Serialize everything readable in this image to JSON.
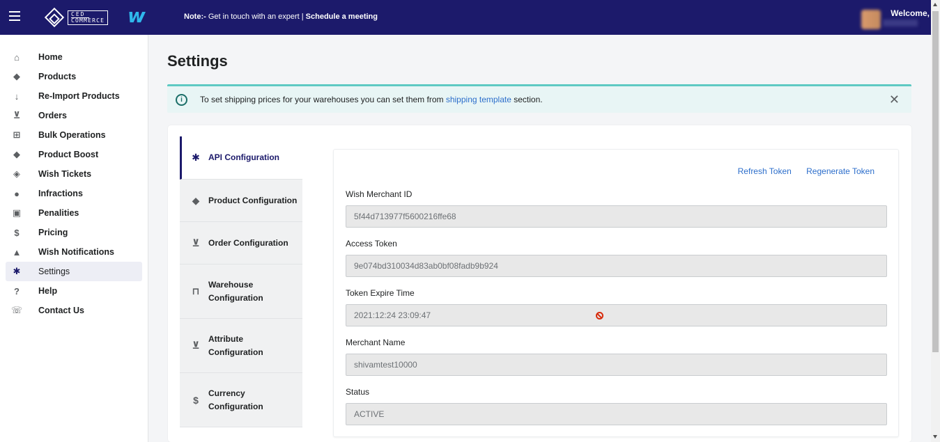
{
  "topbar": {
    "brand_top": "CED",
    "brand_bottom": "COMMERCE",
    "wish_logo": "w",
    "note_prefix": "Note:-",
    "note_text": " Get in touch with an expert | ",
    "note_link": "Schedule a meeting",
    "welcome": "Welcome,"
  },
  "sidebar": {
    "items": [
      {
        "label": "Home",
        "icon": "home-icon",
        "glyph": "⌂"
      },
      {
        "label": "Products",
        "icon": "tag-icon",
        "glyph": "◆"
      },
      {
        "label": "Re-Import Products",
        "icon": "arrow-down-icon",
        "glyph": "↓"
      },
      {
        "label": "Orders",
        "icon": "inbox-download-icon",
        "glyph": "⊻"
      },
      {
        "label": "Bulk Operations",
        "icon": "grid-plus-icon",
        "glyph": "⊞"
      },
      {
        "label": "Product Boost",
        "icon": "tag-icon",
        "glyph": "◆"
      },
      {
        "label": "Wish Tickets",
        "icon": "ticket-icon",
        "glyph": "◈"
      },
      {
        "label": "Infractions",
        "icon": "alert-icon",
        "glyph": "●"
      },
      {
        "label": "Penalities",
        "icon": "percent-icon",
        "glyph": "▣"
      },
      {
        "label": "Pricing",
        "icon": "dollar-icon",
        "glyph": "$"
      },
      {
        "label": "Wish Notifications",
        "icon": "bell-icon",
        "glyph": "▲"
      },
      {
        "label": "Settings",
        "icon": "gear-icon",
        "glyph": "✱"
      },
      {
        "label": "Help",
        "icon": "question-icon",
        "glyph": "?"
      },
      {
        "label": "Contact Us",
        "icon": "phone-icon",
        "glyph": "☏"
      }
    ],
    "active_index": 11
  },
  "page": {
    "title": "Settings"
  },
  "banner": {
    "text_before": "To set shipping prices for your warehouses you can set them from ",
    "link": "shipping template",
    "text_after": " section.",
    "close_glyph": "✕"
  },
  "tabs": [
    {
      "label": "API Configuration",
      "icon": "gear-icon",
      "glyph": "✱"
    },
    {
      "label": "Product Configuration",
      "icon": "tag-icon",
      "glyph": "◆"
    },
    {
      "label": "Order Configuration",
      "icon": "inbox-download-icon",
      "glyph": "⊻"
    },
    {
      "label": "Warehouse Configuration",
      "label_l1": "Warehouse",
      "label_l2": "Configuration",
      "icon": "store-icon",
      "glyph": "⊓"
    },
    {
      "label": "Attribute Configuration",
      "label_l1": "Attribute",
      "label_l2": "Configuration",
      "icon": "import-icon",
      "glyph": "⊻"
    },
    {
      "label": "Currency Configuration",
      "label_l1": "Currency",
      "label_l2": "Configuration",
      "icon": "dollar-icon",
      "glyph": "$"
    }
  ],
  "api": {
    "refresh_token": "Refresh Token",
    "regenerate_token": "Regenerate Token",
    "fields": [
      {
        "label": "Wish Merchant ID",
        "value": "5f44d713977f5600216ffe68"
      },
      {
        "label": "Access Token",
        "value": "9e074bd310034d83ab0bf08fadb9b924"
      },
      {
        "label": "Token Expire Time",
        "value": "2021:12:24 23:09:47"
      },
      {
        "label": "Merchant Name",
        "value": "shivamtest10000"
      },
      {
        "label": "Status",
        "value": "ACTIVE"
      }
    ]
  },
  "colors": {
    "topbar": "#1c1a6b",
    "link": "#2c6ecb",
    "banner_bg": "#e8f5f5",
    "banner_border": "#5ec9c3"
  }
}
